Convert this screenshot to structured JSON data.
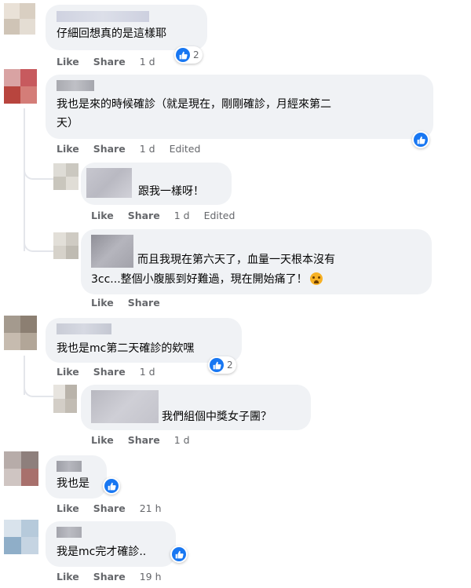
{
  "actions": {
    "like": "Like",
    "share": "Share",
    "edited": "Edited"
  },
  "comments": [
    {
      "text": "仔細回想真的是這樣耶",
      "time": "1 d",
      "reaction_count": "2"
    },
    {
      "text_line1": "我也是來的時候確診（就是現在，剛剛確診，月經來第二",
      "text_line2": "天）",
      "time": "1 d"
    },
    {
      "text": "跟我一樣呀！",
      "time": "1 d"
    },
    {
      "text_line1": "而且我現在第六天了，血量一天根本沒有",
      "text_line2": "3cc...整個小腹脹到好難過，現在開始痛了！",
      "time": ""
    },
    {
      "text": "我也是mc第二天確診的欸嘿",
      "time": "1 d",
      "reaction_count": "2"
    },
    {
      "text": "我們組個中獎女子團？",
      "time": "1 d"
    },
    {
      "text": "我也是",
      "time": "21 h"
    },
    {
      "text": "我是mc完才確診..",
      "time": "19 h"
    }
  ],
  "icons": {
    "like": "like-icon",
    "crying_emoji": "crying-face-emoji"
  },
  "colors": {
    "like_blue": "#1877f2",
    "bubble": "#f0f2f5",
    "action_gray": "#65676b"
  }
}
